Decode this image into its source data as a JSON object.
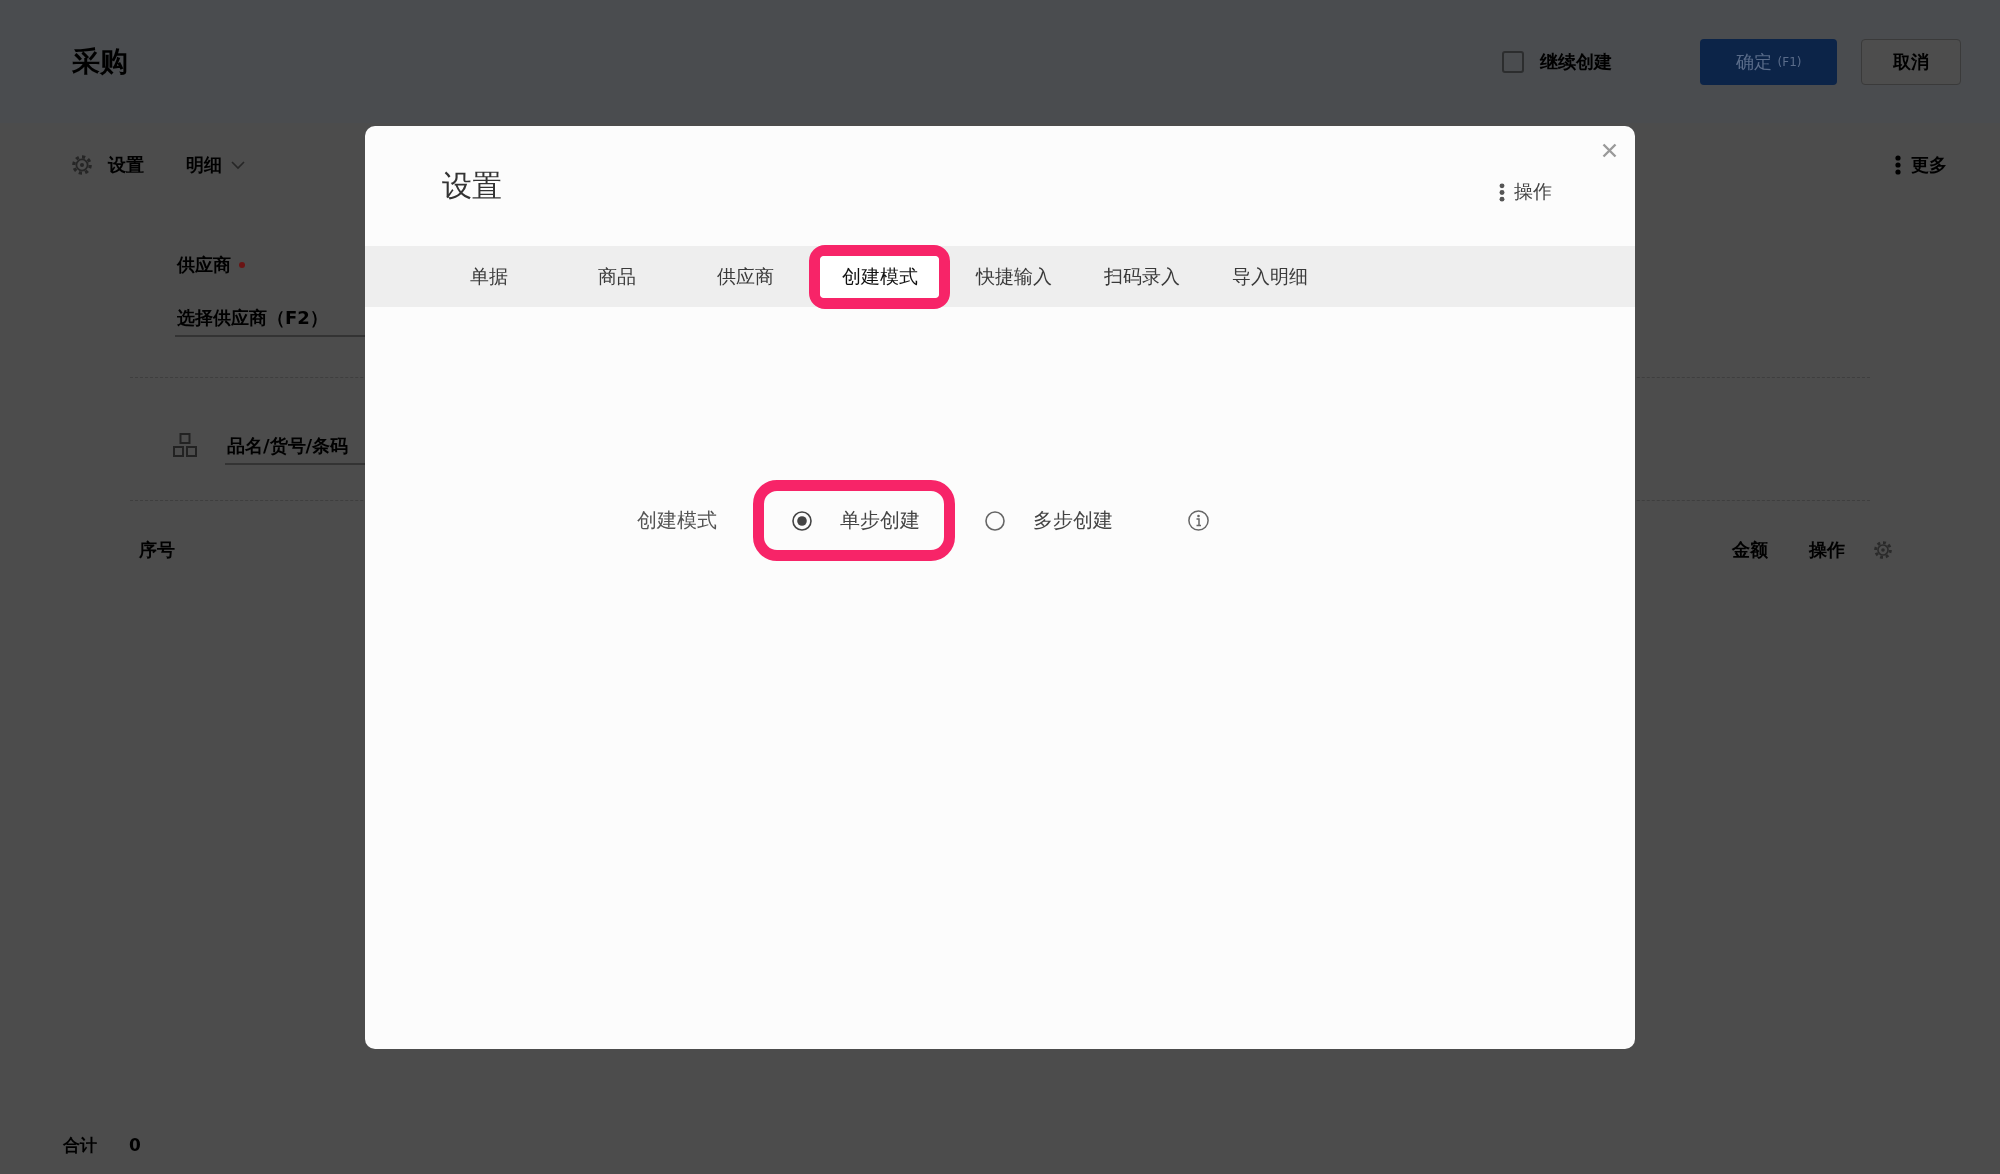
{
  "page": {
    "title": "采购",
    "continue_create": {
      "label": "继续创建",
      "checked": false
    },
    "buttons": [
      {
        "label": "确定",
        "shortcut": "(F1)",
        "kind": "primary"
      },
      {
        "label": "取消",
        "kind": "default"
      }
    ],
    "toolbar": {
      "settings": "设置",
      "view": "明细",
      "more": "更多"
    },
    "supplier": {
      "label": "供应商",
      "required": true,
      "placeholder": "选择供应商（F2）"
    },
    "product_search": {
      "placeholder": "品名/货号/条码"
    },
    "table": {
      "columns": [
        "序号",
        "金额",
        "操作"
      ]
    },
    "total": {
      "label": "合计",
      "value": "0"
    }
  },
  "dialog": {
    "title": "设置",
    "action": "操作",
    "tabs": [
      {
        "label": "单据",
        "selected": false,
        "highlighted": false
      },
      {
        "label": "商品",
        "selected": false,
        "highlighted": false
      },
      {
        "label": "供应商",
        "selected": false,
        "highlighted": false
      },
      {
        "label": "创建模式",
        "selected": true,
        "highlighted": true
      },
      {
        "label": "快捷输入",
        "selected": false,
        "highlighted": false
      },
      {
        "label": "扫码录入",
        "selected": false,
        "highlighted": false
      },
      {
        "label": "导入明细",
        "selected": false,
        "highlighted": false
      }
    ],
    "setting": {
      "label": "创建模式",
      "options": [
        {
          "label": "单步创建",
          "selected": true,
          "highlighted": true
        },
        {
          "label": "多步创建",
          "selected": false,
          "highlighted": false
        }
      ]
    }
  }
}
